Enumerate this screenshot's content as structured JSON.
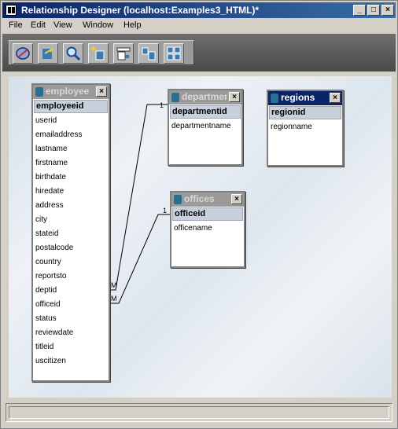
{
  "window": {
    "title": "Relationship Designer  (localhost:Examples3_HTML)*"
  },
  "titlebar_buttons": {
    "minimize": "_",
    "maximize": "□",
    "close": "×"
  },
  "menu": [
    "File",
    "Edit",
    "View",
    "Window",
    "Help"
  ],
  "toolbar": [
    {
      "icon": "compass-icon"
    },
    {
      "icon": "export-icon"
    },
    {
      "icon": "zoom-icon"
    },
    {
      "icon": "add-table-icon"
    },
    {
      "icon": "print-icon"
    },
    {
      "icon": "arrange-icon"
    },
    {
      "icon": "layout-icon"
    }
  ],
  "tables": {
    "employee": {
      "title": "employee",
      "key": "employeeid",
      "fields": [
        "userid",
        "emailaddress",
        "lastname",
        "firstname",
        "birthdate",
        "hiredate",
        "address",
        "city",
        "stateid",
        "postalcode",
        "country",
        "reportsto",
        "deptid",
        "officeid",
        "status",
        "reviewdate",
        "titleid",
        "uscitizen"
      ]
    },
    "department": {
      "title": "department",
      "key": "departmentid",
      "fields": [
        "departmentname"
      ]
    },
    "regions": {
      "title": "regions",
      "key": "regionid",
      "fields": [
        "regionname"
      ]
    },
    "offices": {
      "title": "offices",
      "key": "officeid",
      "fields": [
        "officename"
      ]
    }
  },
  "relations": {
    "dept_one": "1",
    "dept_many": "M",
    "office_one": "1",
    "office_many": "M"
  },
  "close_glyph": "×"
}
